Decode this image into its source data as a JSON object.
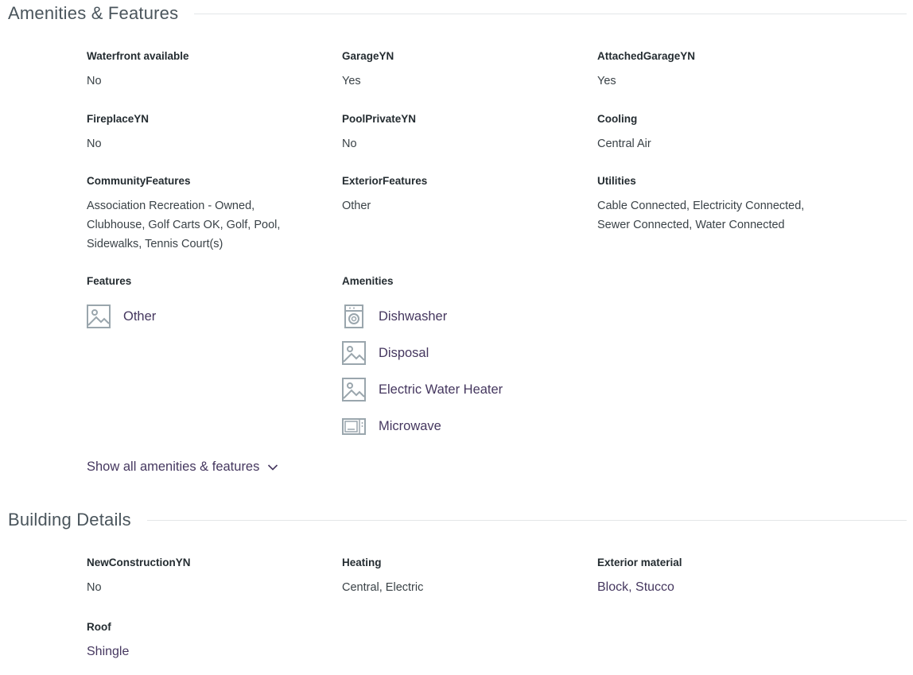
{
  "amenities_section": {
    "title": "Amenities & Features",
    "fields": [
      {
        "label": "Waterfront available",
        "value": "No"
      },
      {
        "label": "GarageYN",
        "value": "Yes"
      },
      {
        "label": "AttachedGarageYN",
        "value": "Yes"
      },
      {
        "label": "FireplaceYN",
        "value": "No"
      },
      {
        "label": "PoolPrivateYN",
        "value": "No"
      },
      {
        "label": "Cooling",
        "value": "Central Air"
      },
      {
        "label": "CommunityFeatures",
        "value": "Association Recreation - Owned, Clubhouse, Golf Carts OK, Golf, Pool, Sidewalks, Tennis Court(s)"
      },
      {
        "label": "ExteriorFeatures",
        "value": "Other"
      },
      {
        "label": "Utilities",
        "value": "Cable Connected, Electricity Connected, Sewer Connected, Water Connected"
      }
    ],
    "features": {
      "label": "Features",
      "items": [
        {
          "label": "Other",
          "icon": "image-placeholder-icon"
        }
      ]
    },
    "amenities": {
      "label": "Amenities",
      "items": [
        {
          "label": "Dishwasher",
          "icon": "dishwasher-icon"
        },
        {
          "label": "Disposal",
          "icon": "image-placeholder-icon"
        },
        {
          "label": "Electric Water Heater",
          "icon": "image-placeholder-icon"
        },
        {
          "label": "Microwave",
          "icon": "microwave-icon"
        }
      ]
    },
    "show_all_label": "Show all amenities & features"
  },
  "building_section": {
    "title": "Building Details",
    "fields": [
      {
        "label": "NewConstructionYN",
        "value": "No"
      },
      {
        "label": "Heating",
        "value": "Central, Electric"
      },
      {
        "label": "Exterior material",
        "value": "Block, Stucco"
      },
      {
        "label": "Roof",
        "value": "Shingle"
      }
    ]
  },
  "colors": {
    "icon_gray": "#9aa6ad",
    "link_purple": "#45375f",
    "rule": "#e3e6e8"
  }
}
